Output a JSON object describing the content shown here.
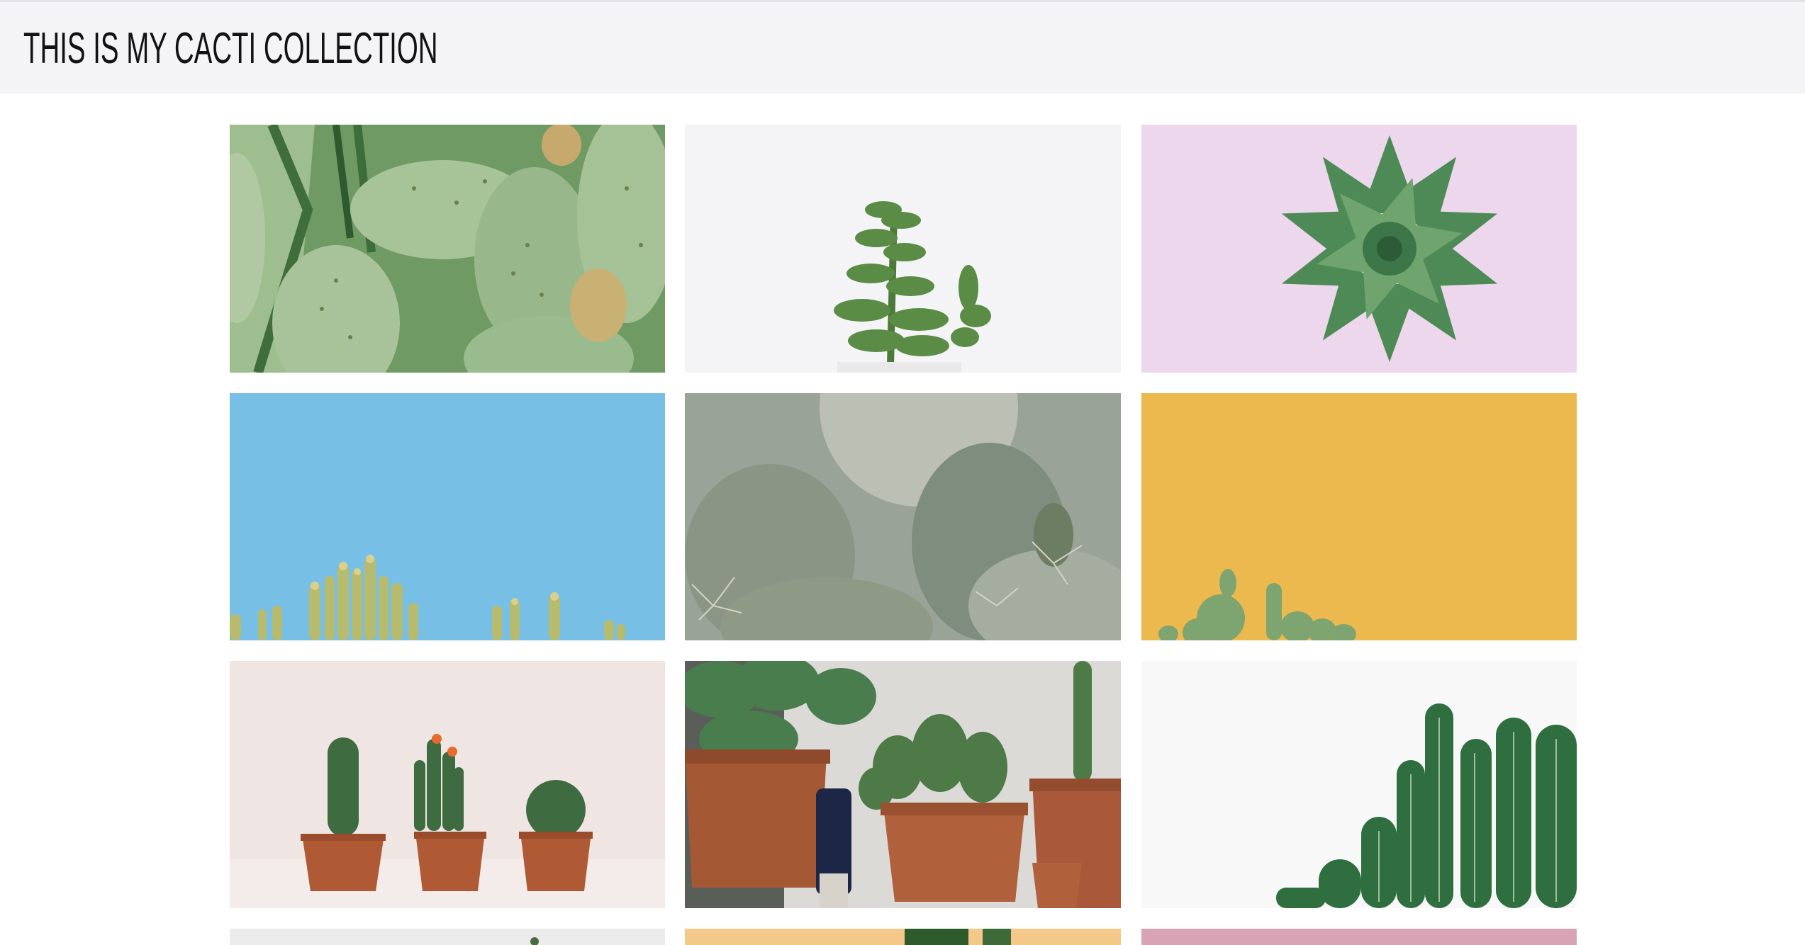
{
  "page": {
    "title": "THIS IS MY CACTI COLLECTION"
  },
  "gallery": {
    "tiles": [
      {
        "name": "prickly-pear-pads-photo",
        "bg": "#a8c39a"
      },
      {
        "name": "succulent-white-background-photo",
        "bg": "#f5f5f6"
      },
      {
        "name": "echeveria-rosette-pink-photo",
        "bg": "#ecd5ec"
      },
      {
        "name": "cactus-tops-blue-sky-photo",
        "bg": "#78bfe6"
      },
      {
        "name": "hazy-prickly-pear-photo",
        "bg": "#9ea69a"
      },
      {
        "name": "cactus-yellow-background-photo",
        "bg": "#ecb94f"
      },
      {
        "name": "three-potted-cacti-photo",
        "bg": "#efe6e4"
      },
      {
        "name": "terracotta-pots-shelf-photo",
        "bg": "#d8d6d2"
      },
      {
        "name": "green-cactus-white-background-photo",
        "bg": "#f7f8f7"
      },
      {
        "name": "partial-tile-grey-photo",
        "bg": "#ebebeb"
      },
      {
        "name": "partial-tile-peach-photo",
        "bg": "#f4c889"
      },
      {
        "name": "partial-tile-pink-photo",
        "bg": "#d9a3b6"
      }
    ]
  }
}
